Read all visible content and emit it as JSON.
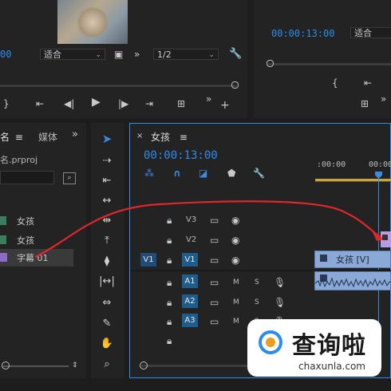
{
  "source_monitor": {
    "timecode_partial": "00",
    "fit_label": "适合",
    "resolution": "1/2"
  },
  "program_monitor": {
    "timecode": "00:00:13:00",
    "fit_label": "适合"
  },
  "project_panel": {
    "tab_project_partial": "名",
    "tab_media_partial": "媒体",
    "project_file_partial": "名.prproj",
    "items": [
      {
        "label": "女孩",
        "icon": "sequence-icon",
        "color": "#3a7f5d"
      },
      {
        "label": "女孩",
        "icon": "clip-icon",
        "color": "#3a7f5d"
      },
      {
        "label": "字幕 01",
        "icon": "title-icon",
        "color": "#8a6bc6"
      }
    ]
  },
  "timeline": {
    "sequence_name": "女孩",
    "timecode": "00:00:13:00",
    "ruler_labels": [
      ":00:00",
      "00:00"
    ],
    "tracks": {
      "video": [
        {
          "name": "V3"
        },
        {
          "name": "V2"
        },
        {
          "name": "V1",
          "source": "V1"
        }
      ],
      "audio": [
        {
          "name": "A1",
          "m": "M",
          "s": "S"
        },
        {
          "name": "A2",
          "m": "M",
          "s": "S"
        },
        {
          "name": "A3",
          "m": "M",
          "s": "S"
        }
      ]
    },
    "clip_label": "女孩 [V]"
  },
  "watermark": {
    "brand": "查询啦",
    "url": "chaxunla.com"
  },
  "colors": {
    "accent_blue": "#2d8ceb",
    "track_blue": "#1e5c8c",
    "clip_video": "#8aa9d6",
    "clip_title": "#b89be0",
    "arrow_red": "#e0262b"
  }
}
